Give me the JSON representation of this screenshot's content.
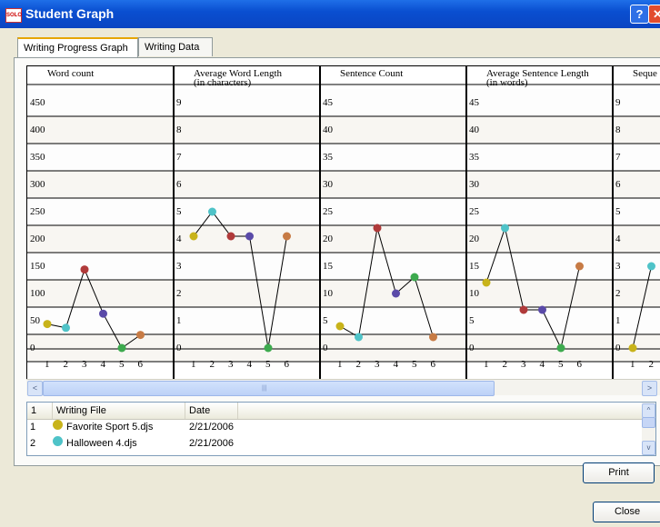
{
  "window": {
    "title": "Student Graph",
    "logo": "SOLO",
    "help_label": "?",
    "close_glyph": "✕"
  },
  "tabs": [
    {
      "label": "Writing Progress Graph",
      "active": true
    },
    {
      "label": "Writing Data",
      "active": false
    }
  ],
  "chart_data": [
    {
      "type": "line",
      "title": "Word count",
      "x": [
        1,
        2,
        3,
        4,
        5,
        6
      ],
      "yticks": [
        0,
        50,
        100,
        150,
        200,
        250,
        300,
        350,
        400,
        450
      ],
      "ylim": [
        0,
        450
      ],
      "values": [
        44,
        37,
        144,
        63,
        0,
        24
      ]
    },
    {
      "type": "line",
      "title": "Average Word Length (in characters)",
      "x": [
        1,
        2,
        3,
        4,
        5,
        6
      ],
      "yticks": [
        0,
        1,
        2,
        3,
        4,
        5,
        6,
        7,
        8,
        9
      ],
      "ylim": [
        0,
        9
      ],
      "values": [
        4.1,
        5.0,
        4.1,
        4.1,
        0,
        4.1
      ]
    },
    {
      "type": "line",
      "title": "Sentence Count",
      "x": [
        1,
        2,
        3,
        4,
        5,
        6
      ],
      "yticks": [
        0,
        5,
        10,
        15,
        20,
        25,
        30,
        35,
        40,
        45
      ],
      "ylim": [
        0,
        45
      ],
      "values": [
        4,
        2,
        22,
        10,
        13,
        2
      ]
    },
    {
      "type": "line",
      "title": "Average Sentence Length (in words)",
      "x": [
        1,
        2,
        3,
        4,
        5,
        6
      ],
      "yticks": [
        0,
        5,
        10,
        15,
        20,
        25,
        30,
        35,
        40,
        45
      ],
      "ylim": [
        0,
        45
      ],
      "values": [
        12,
        22,
        7,
        7,
        0,
        15
      ]
    },
    {
      "type": "line",
      "title": "Seque",
      "x": [
        1,
        2
      ],
      "yticks": [
        0,
        1,
        2,
        3,
        4,
        5,
        6,
        7,
        8,
        9
      ],
      "ylim": [
        0,
        9
      ],
      "values": [
        0,
        3
      ]
    }
  ],
  "point_colors": [
    "#c8b31a",
    "#4fc3c8",
    "#b03a3a",
    "#5a4aa8",
    "#3daa4e",
    "#c77b45"
  ],
  "scroll": {
    "left_arrow": "<",
    "right_arrow": ">",
    "grip": "|||"
  },
  "file_list": {
    "col_num": "1",
    "col_file": "Writing File",
    "col_date": "Date",
    "rows": [
      {
        "num": "1",
        "file": "Favorite Sport 5.djs",
        "date": "2/21/2006",
        "color": "#c8b31a"
      },
      {
        "num": "2",
        "file": "Halloween 4.djs",
        "date": "2/21/2006",
        "color": "#4fc3c8"
      }
    ],
    "up_arrow": "^",
    "down_arrow": "v"
  },
  "buttons": {
    "print": "Print",
    "close": "Close"
  }
}
